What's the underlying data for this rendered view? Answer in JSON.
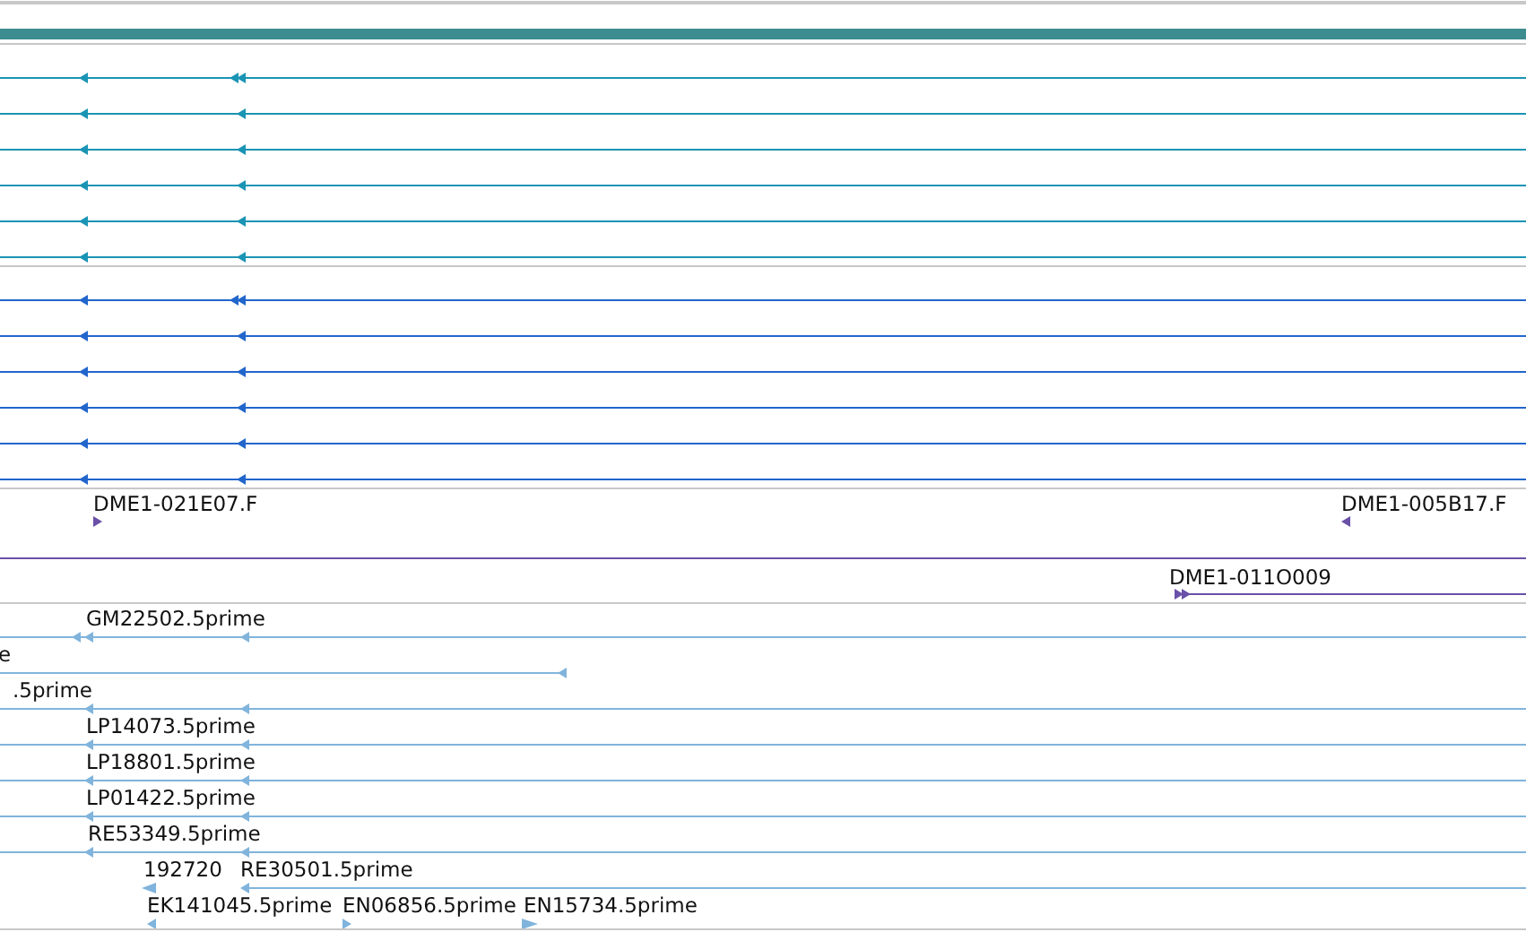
{
  "tracks": [
    {
      "kind": "bar",
      "color": "#3d8c8f"
    },
    {
      "kind": "alignment",
      "color": "#1a94b4",
      "rows": [
        {
          "double_head": true
        },
        {
          "double_head": false
        },
        {
          "double_head": false
        },
        {
          "double_head": false
        },
        {
          "double_head": false
        },
        {
          "double_head": false
        }
      ]
    },
    {
      "kind": "alignment",
      "color": "#2266cc",
      "rows": [
        {
          "double_head": true
        },
        {
          "double_head": false
        },
        {
          "double_head": false
        },
        {
          "double_head": false
        },
        {
          "double_head": false
        },
        {
          "double_head": false
        }
      ]
    },
    {
      "kind": "labelled",
      "color": "#6a50a8",
      "features": [
        {
          "label": "DME1-021E07.F",
          "forward": true
        },
        {
          "label": "DME1-005B17.F",
          "forward": false
        }
      ]
    },
    {
      "kind": "spanning",
      "color": "#6a50a8",
      "features": [
        {
          "label": "DME1-011O009",
          "forward": true
        }
      ]
    },
    {
      "kind": "est",
      "color": "#80b4dc",
      "rows": [
        {
          "labels": [
            "GM22502.5prime"
          ]
        },
        {
          "labels": [
            "e"
          ]
        },
        {
          "labels": [
            ".5prime"
          ]
        },
        {
          "labels": [
            "LP14073.5prime"
          ]
        },
        {
          "labels": [
            "LP18801.5prime"
          ]
        },
        {
          "labels": [
            "LP01422.5prime"
          ]
        },
        {
          "labels": [
            "RE53349.5prime"
          ]
        },
        {
          "labels": [
            "192720",
            "RE30501.5prime"
          ]
        },
        {
          "labels": [
            "EK141045.5prime",
            "EN06856.5prime",
            "EN15734.5prime"
          ]
        }
      ]
    }
  ]
}
